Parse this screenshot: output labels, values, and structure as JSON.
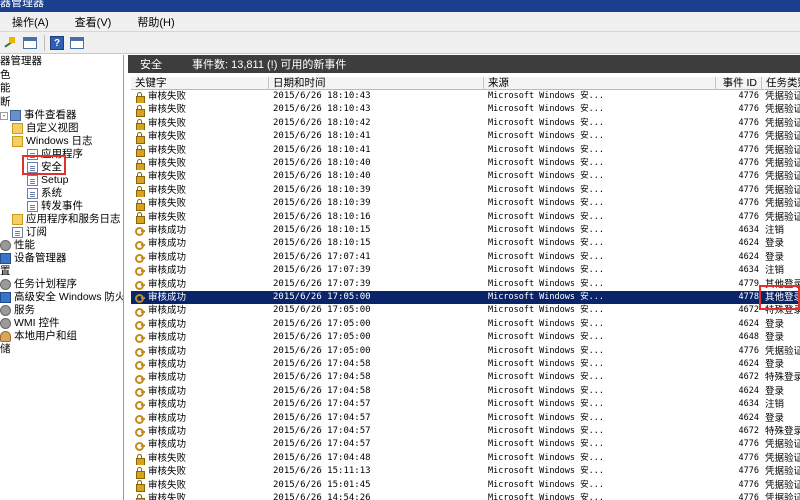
{
  "window": {
    "title": "器管理器"
  },
  "menu": {
    "items": [
      {
        "label": "操作(A)"
      },
      {
        "label": "查看(V)"
      },
      {
        "label": "帮助(H)"
      }
    ]
  },
  "toolbar": {
    "buttons": [
      "back-forward-icon",
      "console-tree-icon",
      "help-icon",
      "action-pane-icon"
    ]
  },
  "tree": {
    "items": [
      {
        "label": "器管理器",
        "icon": "computer-icon"
      },
      {
        "label": "色",
        "icon": ""
      },
      {
        "label": "能",
        "icon": ""
      },
      {
        "label": "断",
        "icon": ""
      },
      {
        "label": "事件查看器",
        "icon": "viewer-icon"
      },
      {
        "label": "自定义视图",
        "icon": "folder-icon"
      },
      {
        "label": "Windows 日志",
        "icon": "folder-icon"
      },
      {
        "label": "应用程序",
        "icon": "log-icon"
      },
      {
        "label": "安全",
        "icon": "log-icon"
      },
      {
        "label": "Setup",
        "icon": "log-icon"
      },
      {
        "label": "系统",
        "icon": "log-icon"
      },
      {
        "label": "转发事件",
        "icon": "log-icon"
      },
      {
        "label": "应用程序和服务日志",
        "icon": "folder-icon"
      },
      {
        "label": "订阅",
        "icon": "log-icon"
      },
      {
        "label": "性能",
        "icon": "gear-icon"
      },
      {
        "label": "设备管理器",
        "icon": "monitor-icon"
      },
      {
        "label": "置",
        "icon": ""
      },
      {
        "label": "任务计划程序",
        "icon": "gear-icon"
      },
      {
        "label": "高级安全 Windows 防火墙",
        "icon": "monitor-icon"
      },
      {
        "label": "服务",
        "icon": "gear-icon"
      },
      {
        "label": "WMI 控件",
        "icon": "gear-icon"
      },
      {
        "label": "本地用户和组",
        "icon": "user-icon"
      },
      {
        "label": "储",
        "icon": ""
      }
    ]
  },
  "pane": {
    "title": "安全",
    "count_text": "事件数: 13,811 (!) 可用的新事件"
  },
  "columns": {
    "keyword": "关键字",
    "datetime": "日期和时间",
    "source": "来源",
    "event_id": "事件 ID",
    "category": "任务类别"
  },
  "rows": [
    {
      "kw": "审核失败",
      "dt": "2015/6/26 18:10:43",
      "src": "Microsoft Windows 安...",
      "id": "4776",
      "cat": "凭据验证",
      "icon": "lock-icon"
    },
    {
      "kw": "审核失败",
      "dt": "2015/6/26 18:10:43",
      "src": "Microsoft Windows 安...",
      "id": "4776",
      "cat": "凭据验证",
      "icon": "lock-icon"
    },
    {
      "kw": "审核失败",
      "dt": "2015/6/26 18:10:42",
      "src": "Microsoft Windows 安...",
      "id": "4776",
      "cat": "凭据验证",
      "icon": "lock-icon"
    },
    {
      "kw": "审核失败",
      "dt": "2015/6/26 18:10:41",
      "src": "Microsoft Windows 安...",
      "id": "4776",
      "cat": "凭据验证",
      "icon": "lock-icon"
    },
    {
      "kw": "审核失败",
      "dt": "2015/6/26 18:10:41",
      "src": "Microsoft Windows 安...",
      "id": "4776",
      "cat": "凭据验证",
      "icon": "lock-icon"
    },
    {
      "kw": "审核失败",
      "dt": "2015/6/26 18:10:40",
      "src": "Microsoft Windows 安...",
      "id": "4776",
      "cat": "凭据验证",
      "icon": "lock-icon"
    },
    {
      "kw": "审核失败",
      "dt": "2015/6/26 18:10:40",
      "src": "Microsoft Windows 安...",
      "id": "4776",
      "cat": "凭据验证",
      "icon": "lock-icon"
    },
    {
      "kw": "审核失败",
      "dt": "2015/6/26 18:10:39",
      "src": "Microsoft Windows 安...",
      "id": "4776",
      "cat": "凭据验证",
      "icon": "lock-icon"
    },
    {
      "kw": "审核失败",
      "dt": "2015/6/26 18:10:39",
      "src": "Microsoft Windows 安...",
      "id": "4776",
      "cat": "凭据验证",
      "icon": "lock-icon"
    },
    {
      "kw": "审核失败",
      "dt": "2015/6/26 18:10:16",
      "src": "Microsoft Windows 安...",
      "id": "4776",
      "cat": "凭据验证",
      "icon": "lock-icon"
    },
    {
      "kw": "审核成功",
      "dt": "2015/6/26 18:10:15",
      "src": "Microsoft Windows 安...",
      "id": "4634",
      "cat": "注销",
      "icon": "key-icon"
    },
    {
      "kw": "审核成功",
      "dt": "2015/6/26 18:10:15",
      "src": "Microsoft Windows 安...",
      "id": "4624",
      "cat": "登录",
      "icon": "key-icon"
    },
    {
      "kw": "审核成功",
      "dt": "2015/6/26 17:07:41",
      "src": "Microsoft Windows 安...",
      "id": "4624",
      "cat": "登录",
      "icon": "key-icon"
    },
    {
      "kw": "审核成功",
      "dt": "2015/6/26 17:07:39",
      "src": "Microsoft Windows 安...",
      "id": "4634",
      "cat": "注销",
      "icon": "key-icon"
    },
    {
      "kw": "审核成功",
      "dt": "2015/6/26 17:07:39",
      "src": "Microsoft Windows 安...",
      "id": "4779",
      "cat": "其他登录",
      "icon": "key-icon"
    },
    {
      "kw": "审核成功",
      "dt": "2015/6/26 17:05:00",
      "src": "Microsoft Windows 安...",
      "id": "4778",
      "cat": "其他登录",
      "icon": "key-icon",
      "selected": true
    },
    {
      "kw": "审核成功",
      "dt": "2015/6/26 17:05:00",
      "src": "Microsoft Windows 安...",
      "id": "4672",
      "cat": "特殊登录",
      "icon": "key-icon"
    },
    {
      "kw": "审核成功",
      "dt": "2015/6/26 17:05:00",
      "src": "Microsoft Windows 安...",
      "id": "4624",
      "cat": "登录",
      "icon": "key-icon"
    },
    {
      "kw": "审核成功",
      "dt": "2015/6/26 17:05:00",
      "src": "Microsoft Windows 安...",
      "id": "4648",
      "cat": "登录",
      "icon": "key-icon"
    },
    {
      "kw": "审核成功",
      "dt": "2015/6/26 17:05:00",
      "src": "Microsoft Windows 安...",
      "id": "4776",
      "cat": "凭据验证",
      "icon": "key-icon"
    },
    {
      "kw": "审核成功",
      "dt": "2015/6/26 17:04:58",
      "src": "Microsoft Windows 安...",
      "id": "4624",
      "cat": "登录",
      "icon": "key-icon"
    },
    {
      "kw": "审核成功",
      "dt": "2015/6/26 17:04:58",
      "src": "Microsoft Windows 安...",
      "id": "4672",
      "cat": "特殊登录",
      "icon": "key-icon"
    },
    {
      "kw": "审核成功",
      "dt": "2015/6/26 17:04:58",
      "src": "Microsoft Windows 安...",
      "id": "4624",
      "cat": "登录",
      "icon": "key-icon"
    },
    {
      "kw": "审核成功",
      "dt": "2015/6/26 17:04:57",
      "src": "Microsoft Windows 安...",
      "id": "4634",
      "cat": "注销",
      "icon": "key-icon"
    },
    {
      "kw": "审核成功",
      "dt": "2015/6/26 17:04:57",
      "src": "Microsoft Windows 安...",
      "id": "4624",
      "cat": "登录",
      "icon": "key-icon"
    },
    {
      "kw": "审核成功",
      "dt": "2015/6/26 17:04:57",
      "src": "Microsoft Windows 安...",
      "id": "4672",
      "cat": "特殊登录",
      "icon": "key-icon"
    },
    {
      "kw": "审核成功",
      "dt": "2015/6/26 17:04:57",
      "src": "Microsoft Windows 安...",
      "id": "4776",
      "cat": "凭据验证",
      "icon": "key-icon"
    },
    {
      "kw": "审核失败",
      "dt": "2015/6/26 17:04:48",
      "src": "Microsoft Windows 安...",
      "id": "4776",
      "cat": "凭据验证",
      "icon": "lock-icon"
    },
    {
      "kw": "审核失败",
      "dt": "2015/6/26 15:11:13",
      "src": "Microsoft Windows 安...",
      "id": "4776",
      "cat": "凭据验证",
      "icon": "lock-icon"
    },
    {
      "kw": "审核失败",
      "dt": "2015/6/26 15:01:45",
      "src": "Microsoft Windows 安...",
      "id": "4776",
      "cat": "凭据验证",
      "icon": "lock-icon"
    },
    {
      "kw": "审核失败",
      "dt": "2015/6/26 14:54:26",
      "src": "Microsoft Windows 安...",
      "id": "4776",
      "cat": "凭据验证",
      "icon": "lock-icon"
    }
  ],
  "colors": {
    "selection": "#0a246a",
    "highlight_box": "#e03030",
    "pane_header": "#3d3d3d",
    "title_bar": "#1a3f8e"
  }
}
